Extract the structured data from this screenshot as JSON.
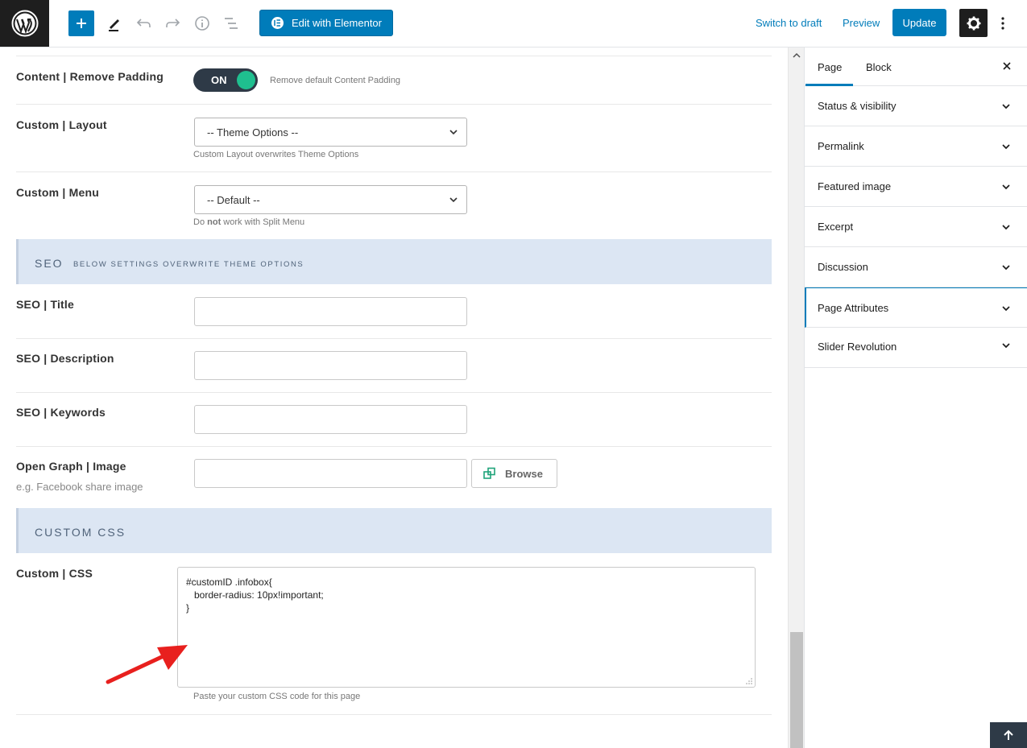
{
  "toolbar": {
    "edit_with_elementor": "Edit with Elementor",
    "switch_to_draft": "Switch to draft",
    "preview": "Preview",
    "update": "Update"
  },
  "content": {
    "remove_padding": {
      "label": "Content | Remove Padding",
      "toggle": "ON",
      "help": "Remove default Content Padding"
    },
    "custom_layout": {
      "label": "Custom | Layout",
      "value": "-- Theme Options --",
      "help": "Custom Layout overwrites Theme Options"
    },
    "custom_menu": {
      "label": "Custom | Menu",
      "value": "-- Default --",
      "help_pre": "Do",
      "help_bold": "not",
      "help_post": "work with Split Menu"
    },
    "seo_section": {
      "title": "SEO",
      "subtitle": "BELOW SETTINGS OVERWRITE THEME OPTIONS"
    },
    "seo_title": {
      "label": "SEO | Title",
      "value": ""
    },
    "seo_description": {
      "label": "SEO | Description",
      "value": ""
    },
    "seo_keywords": {
      "label": "SEO | Keywords",
      "value": ""
    },
    "og_image": {
      "label": "Open Graph | Image",
      "sublabel": "e.g. Facebook share image",
      "value": "",
      "browse": "Browse"
    },
    "css_section": {
      "title": "CUSTOM CSS"
    },
    "custom_css": {
      "label": "Custom | CSS",
      "lines": [
        "#customID .infobox{",
        "   border-radius: 10px!important;",
        "}"
      ],
      "help": "Paste your custom CSS code for this page"
    }
  },
  "sidebar": {
    "tabs": [
      "Page",
      "Block"
    ],
    "active_tab": "Page",
    "panels": [
      "Status & visibility",
      "Permalink",
      "Featured image",
      "Excerpt",
      "Discussion",
      "Page Attributes",
      "Slider Revolution"
    ],
    "active_panel": "Page Attributes"
  },
  "colors": {
    "accent": "#007cba",
    "toggle_knob": "#1fbf8f",
    "section_band": "#dce6f3",
    "annotation_arrow": "#e8201e"
  },
  "icons": [
    "wordpress-logo-icon",
    "plus-icon",
    "pencil-icon",
    "undo-icon",
    "redo-icon",
    "info-icon",
    "outline-icon",
    "elementor-icon",
    "gear-icon",
    "more-vertical-icon",
    "chevron-down-icon",
    "close-icon",
    "media-icon",
    "arrow-up-icon"
  ]
}
